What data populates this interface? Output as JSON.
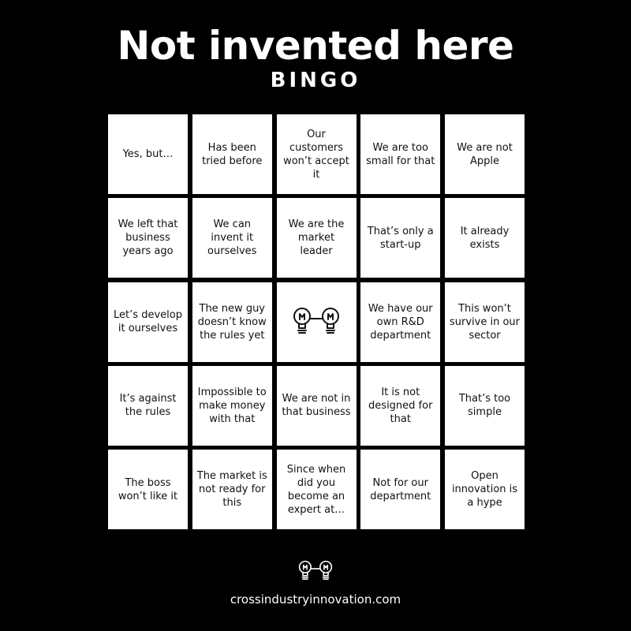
{
  "header": {
    "title": "Not invented here",
    "subtitle": "BINGO"
  },
  "board": {
    "rows": [
      [
        "Yes, but…",
        "Has been tried before",
        "Our customers won’t accept it",
        "We are too small for that",
        "We are not Apple"
      ],
      [
        "We left that business years ago",
        "We can invent it ourselves",
        "We are the market leader",
        "That’s only a start-up",
        "It already exists"
      ],
      [
        "Let’s develop it ourselves",
        "The new guy doesn’t know the rules yet",
        "",
        "We have our own R&D department",
        "This won’t survive in our sector"
      ],
      [
        "It’s against the rules",
        "Impossible to make money with that",
        "We are not in that business",
        "It is not designed for that",
        "That’s too simple"
      ],
      [
        "The boss won’t like it",
        "The market is not ready for this",
        "Since when did you become an expert at…",
        "Not for our department",
        "Open innovation is a hype"
      ]
    ],
    "center_icon": "connected-lightbulbs-icon"
  },
  "footer": {
    "icon": "connected-lightbulbs-icon",
    "url": "crossindustryinnovation.com"
  },
  "colors": {
    "background": "#000000",
    "cell_background": "#ffffff",
    "cell_text": "#111111",
    "header_text": "#ffffff"
  }
}
